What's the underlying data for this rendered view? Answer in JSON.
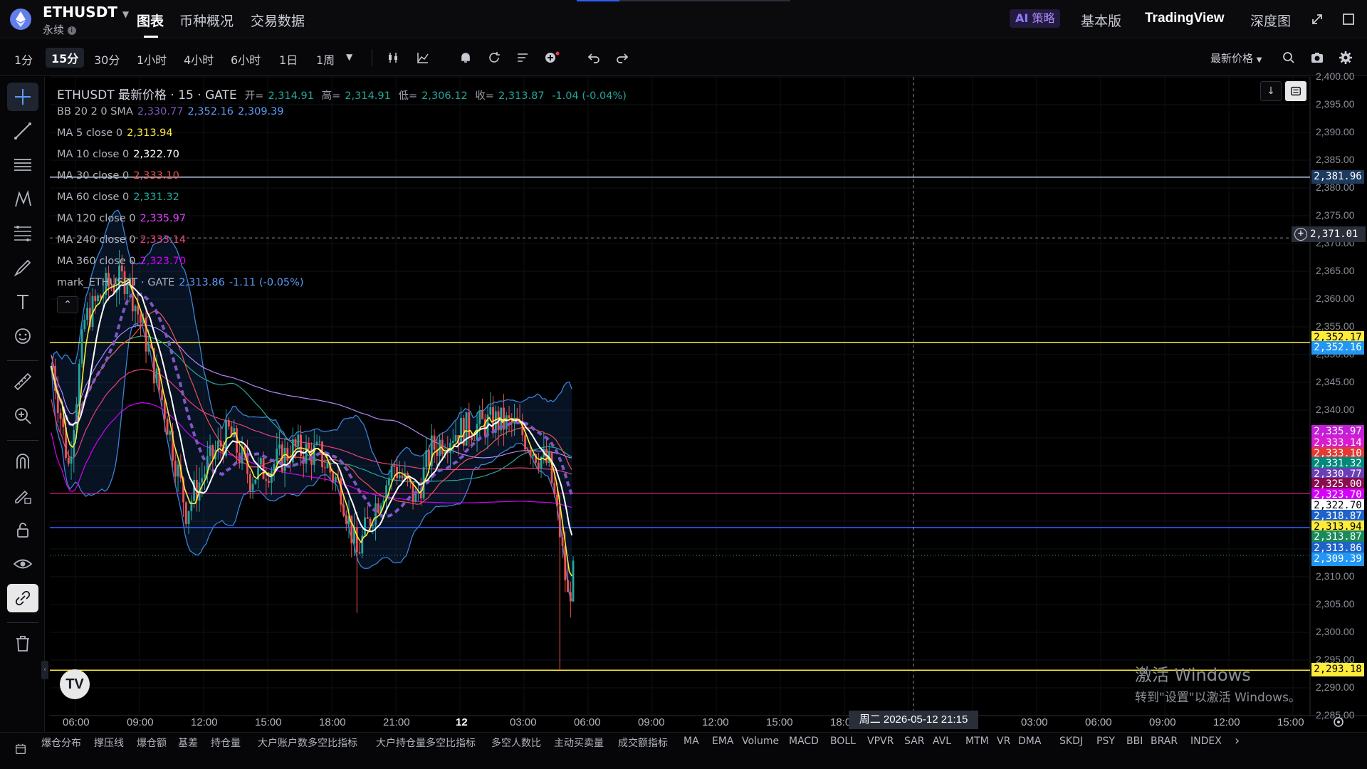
{
  "header": {
    "symbol": "ETHUSDT",
    "contract_type": "永续",
    "tabs": [
      "图表",
      "币种概况",
      "交易数据"
    ],
    "ai_label": "策略",
    "ai_prefix": "AI",
    "view_basic": "基本版",
    "view_tradingview": "TradingView",
    "view_depth": "深度图"
  },
  "toolbar": {
    "intervals": [
      "1分",
      "15分",
      "30分",
      "1小时",
      "4小时",
      "6小时",
      "1日",
      "1周"
    ],
    "active_interval": "15分",
    "price_type": "最新价格"
  },
  "legend": {
    "title": "ETHUSDT 最新价格 · 15 · GATE",
    "open_label": "开=",
    "open": "2,314.91",
    "high_label": "高=",
    "high": "2,314.91",
    "low_label": "低=",
    "low": "2,306.12",
    "close_label": "收=",
    "close": "2,313.87",
    "change": "-1.04 (-0.04%)",
    "indicators": [
      {
        "label": "BB 20 2 0 SMA",
        "values": [
          "2,330.77",
          "2,352.16",
          "2,309.39"
        ],
        "colors": [
          "#7e57c2",
          "#5b9cf6",
          "#5b9cf6"
        ]
      },
      {
        "label": "MA 5 close 0",
        "values": [
          "2,313.94"
        ],
        "colors": [
          "#ffeb3b"
        ]
      },
      {
        "label": "MA 10 close 0",
        "values": [
          "2,322.70"
        ],
        "colors": [
          "#ffffff"
        ]
      },
      {
        "label": "MA 30 close 0",
        "values": [
          "2,333.10"
        ],
        "colors": [
          "#ef5350"
        ]
      },
      {
        "label": "MA 60 close 0",
        "values": [
          "2,331.32"
        ],
        "colors": [
          "#26a69a"
        ]
      },
      {
        "label": "MA 120 close 0",
        "values": [
          "2,335.97"
        ],
        "colors": [
          "#e040fb"
        ]
      },
      {
        "label": "MA 240 close 0",
        "values": [
          "2,333.14"
        ],
        "colors": [
          "#ec407a"
        ]
      },
      {
        "label": "MA 360 close 0",
        "values": [
          "2,323.70"
        ],
        "colors": [
          "#d500f9"
        ]
      },
      {
        "label": "mark_ETHUSDT · GATE",
        "values": [
          "2,313.86",
          "-1.11 (-0.05%)"
        ],
        "colors": [
          "#5b9cf6",
          "#5b9cf6"
        ]
      }
    ]
  },
  "price_axis": {
    "ticks": [
      "2,400.00",
      "2,395.00",
      "2,390.00",
      "2,385.00",
      "2,380.00",
      "2,375.00",
      "2,370.00",
      "2,365.00",
      "2,360.00",
      "2,355.00",
      "2,350.00",
      "2,345.00",
      "2,340.00",
      "2,335.00",
      "2,330.00",
      "2,325.00",
      "2,320.00",
      "2,315.00",
      "2,310.00",
      "2,305.00",
      "2,300.00",
      "2,295.00",
      "2,290.00",
      "2,285.00"
    ],
    "crosshair_price": "2,371.01",
    "badges": [
      {
        "value": "2,381.96",
        "price": 2381.96,
        "bg": "#1e3a5f",
        "fg": "#ffffff"
      },
      {
        "value": "2,352.17",
        "price": 2352.9,
        "bg": "#ffeb3b",
        "fg": "#000000"
      },
      {
        "value": "2,352.16",
        "price": 2351.2,
        "bg": "#2196f3",
        "fg": "#ffffff"
      },
      {
        "value": "2,335.97",
        "price": 2336.0,
        "bg": "#c21fd6",
        "fg": "#ffffff"
      },
      {
        "value": "2,333.14",
        "price": 2334.0,
        "bg": "#d81bd0",
        "fg": "#ffffff"
      },
      {
        "value": "2,333.10",
        "price": 2332.1,
        "bg": "#e53935",
        "fg": "#ffffff"
      },
      {
        "value": "2,331.32",
        "price": 2330.2,
        "bg": "#00897b",
        "fg": "#ffffff"
      },
      {
        "value": "2,330.77",
        "price": 2328.3,
        "bg": "#6a3fb5",
        "fg": "#ffffff"
      },
      {
        "value": "2,325.00",
        "price": 2326.5,
        "bg": "#880e4f",
        "fg": "#ffffff"
      },
      {
        "value": "2,323.70",
        "price": 2324.6,
        "bg": "#d500f9",
        "fg": "#ffffff"
      },
      {
        "value": "2,322.70",
        "price": 2322.7,
        "bg": "#ffffff",
        "fg": "#000000"
      },
      {
        "value": "2,318.87",
        "price": 2320.8,
        "bg": "#1e63c8",
        "fg": "#ffffff"
      },
      {
        "value": "2,313.94",
        "price": 2318.9,
        "bg": "#ffeb3b",
        "fg": "#000000"
      },
      {
        "value": "2,313.87",
        "price": 2317.0,
        "bg": "#1b8a5a",
        "fg": "#ffffff"
      },
      {
        "value": "2,313.86",
        "price": 2315.0,
        "bg": "#1e63c8",
        "fg": "#ffffff"
      },
      {
        "value": "2,309.39",
        "price": 2313.1,
        "bg": "#2196f3",
        "fg": "#ffffff"
      },
      {
        "value": "2,293.18",
        "price": 2293.18,
        "bg": "#ffeb3b",
        "fg": "#000000"
      }
    ]
  },
  "time_axis": {
    "ticks": [
      "06:00",
      "09:00",
      "12:00",
      "15:00",
      "18:00",
      "21:00",
      "12",
      "03:00",
      "06:00",
      "09:00",
      "12:00",
      "15:00",
      "18:0",
      "03:00",
      "06:00",
      "09:00",
      "12:00",
      "15:00"
    ],
    "crosshair_time": "周二 2026-05-12   21:15"
  },
  "bottom_indicators": [
    "爆仓分布",
    "撑压线",
    "爆仓额",
    "基差",
    "持仓量",
    "大户账户数多空比指标",
    "大户持仓量多空比指标",
    "多空人数比",
    "主动买卖量",
    "成交额指标",
    "MA",
    "EMA",
    "Volume",
    "MACD",
    "BOLL",
    "VPVR",
    "SAR",
    "AVL",
    "MTM",
    "VR",
    "DMA",
    "SKDJ",
    "PSY",
    "BBI",
    "BRAR",
    "INDEX"
  ],
  "watermark": {
    "line1": "激活 Windows",
    "line2": "转到\"设置\"以激活 Windows。"
  },
  "chart_data": {
    "type": "candlestick",
    "x_range": [
      "06:00",
      "15:00"
    ],
    "ylim": [
      2285,
      2400
    ],
    "horizontal_lines": [
      2381.96,
      2352.17,
      2325.0,
      2318.87,
      2293.18
    ],
    "last_close": 2313.87
  }
}
